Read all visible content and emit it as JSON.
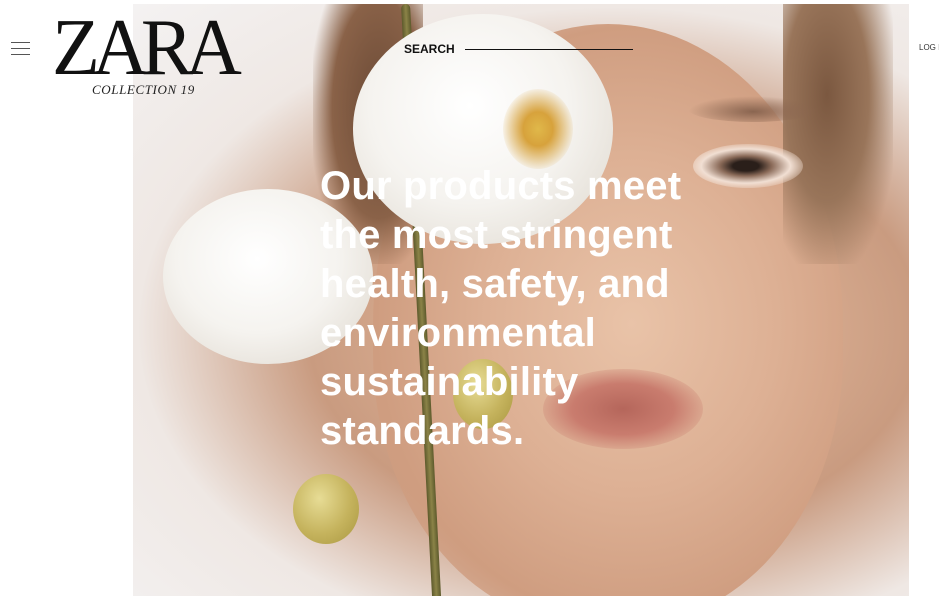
{
  "header": {
    "menu_icon": "hamburger-menu-icon",
    "logo": {
      "brand": "ZARA",
      "subtitle": "COLLECTION 19"
    },
    "search": {
      "label": "SEARCH"
    },
    "login_label": "LOG I"
  },
  "hero": {
    "headline": "Our products meet the most stringent health, safety, and environmental sustainability standards."
  },
  "colors": {
    "text_on_image": "#ffffff",
    "header_text": "#111111",
    "background": "#ffffff"
  }
}
